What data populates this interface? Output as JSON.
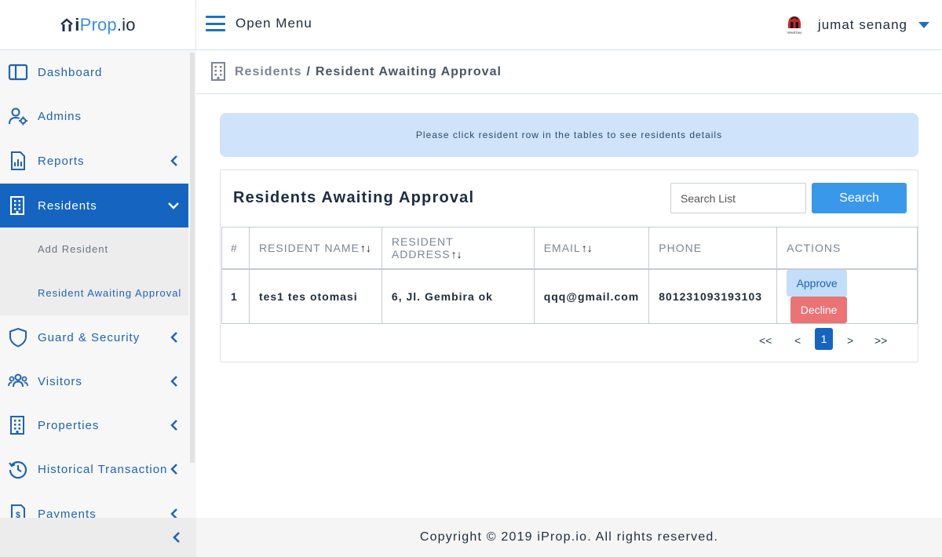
{
  "brand": {
    "logo_text_i": "i",
    "logo_text_prop": "Prop",
    "logo_text_io": ".io"
  },
  "header": {
    "menu_label": "Open Menu",
    "user_name": "jumat senang",
    "avatar_caption": "SPARTAN"
  },
  "sidebar": {
    "items": [
      {
        "label": "Dashboard",
        "icon": "layout-icon",
        "chevron": "none"
      },
      {
        "label": "Admins",
        "icon": "user-gear-icon",
        "chevron": "none"
      },
      {
        "label": "Reports",
        "icon": "report-icon",
        "chevron": "left"
      },
      {
        "label": "Residents",
        "icon": "building-icon",
        "chevron": "down",
        "active": true
      },
      {
        "label": "Guard & Security",
        "icon": "shield-icon",
        "chevron": "left"
      },
      {
        "label": "Visitors",
        "icon": "users-icon",
        "chevron": "left"
      },
      {
        "label": "Properties",
        "icon": "building-icon",
        "chevron": "left"
      },
      {
        "label": "Historical Transaction",
        "icon": "history-icon",
        "chevron": "left"
      },
      {
        "label": "Payments",
        "icon": "invoice-icon",
        "chevron": "left"
      }
    ],
    "sub_items": [
      {
        "label": "Add Resident"
      },
      {
        "label": "Resident Awaiting Approval"
      }
    ]
  },
  "breadcrumb": {
    "parent": "Residents",
    "separator": "/",
    "current": "Resident Awaiting Approval"
  },
  "info_banner": "Please click resident row in the tables to see residents details",
  "card": {
    "title": "Residents Awaiting Approval",
    "search_placeholder": "Search List",
    "search_button": "Search"
  },
  "table": {
    "headers": [
      {
        "label": "#",
        "sortable": false
      },
      {
        "label": "RESIDENT NAME",
        "sortable": true
      },
      {
        "label": "RESIDENT ADDRESS",
        "sortable": true
      },
      {
        "label": "EMAIL",
        "sortable": true
      },
      {
        "label": "PHONE",
        "sortable": false
      },
      {
        "label": "ACTIONS",
        "sortable": false
      }
    ],
    "sort_glyph": "↑↓",
    "rows": [
      {
        "num": "1",
        "name": "tes1 tes otomasi",
        "address": "6, Jl. Gembira ok",
        "email": "qqq@gmail.com",
        "phone": "801231093193103"
      }
    ],
    "approve_label": "Approve",
    "decline_label": "Decline"
  },
  "pagination": {
    "first": "<<",
    "prev": "<",
    "current": "1",
    "next": ">",
    "last": ">>"
  },
  "footer": "Copyright © 2019 iProp.io. All rights reserved.",
  "colors": {
    "primary": "#1565c0",
    "accent": "#3a98ea",
    "decline": "#ea7373",
    "banner": "#cfe3fa"
  }
}
